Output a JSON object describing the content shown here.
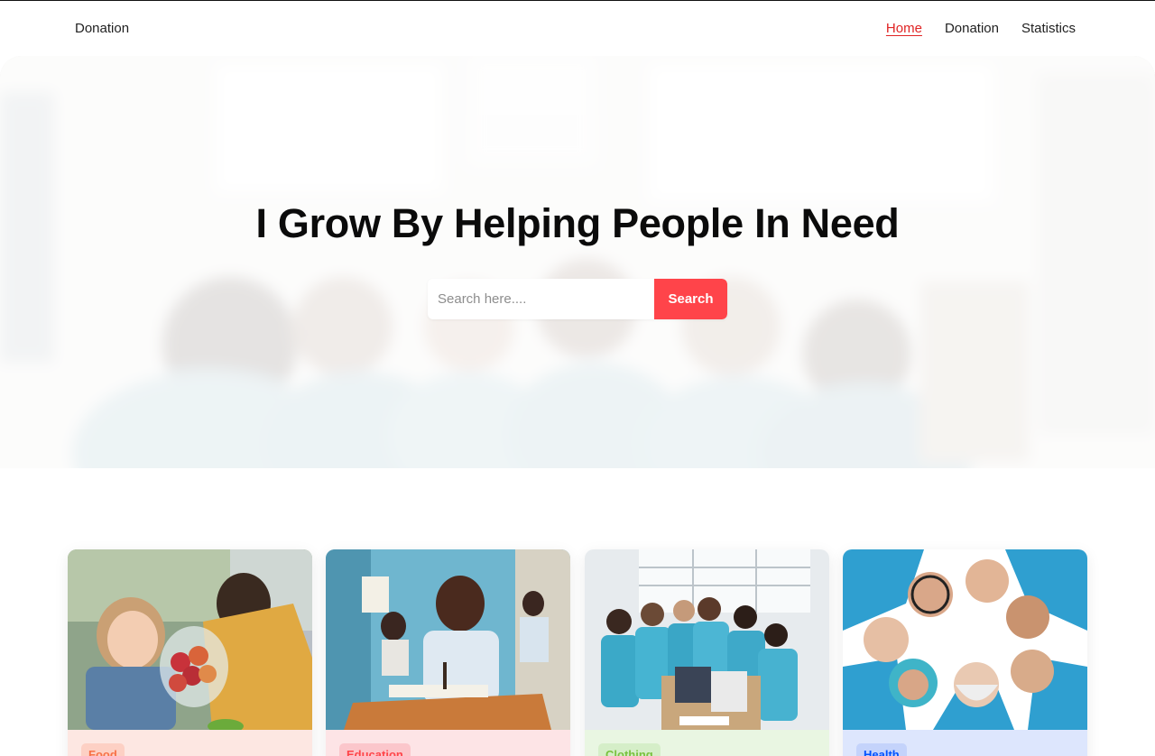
{
  "nav": {
    "brand": "Donation",
    "links": [
      {
        "label": "Home",
        "active": true
      },
      {
        "label": "Donation",
        "active": false
      },
      {
        "label": "Statistics",
        "active": false
      }
    ]
  },
  "hero": {
    "title": "I Grow By Helping People In Need",
    "search_placeholder": "Search here....",
    "search_button": "Search"
  },
  "cards": [
    {
      "category": "Food",
      "card_bg": "#fde7e2",
      "tag_bg": "#fdd0c4",
      "tag_color": "#f87147"
    },
    {
      "category": "Education",
      "card_bg": "#fde4e6",
      "tag_bg": "#fbc6cb",
      "tag_color": "#ff444a"
    },
    {
      "category": "Clothing",
      "card_bg": "#e9f6e2",
      "tag_bg": "#d5eec8",
      "tag_color": "#79c23f"
    },
    {
      "category": "Health",
      "card_bg": "#dde6fd",
      "tag_bg": "#c4d3fb",
      "tag_color": "#0052ff"
    }
  ],
  "colors": {
    "accent": "#ff444a",
    "nav_active": "#e02424"
  }
}
